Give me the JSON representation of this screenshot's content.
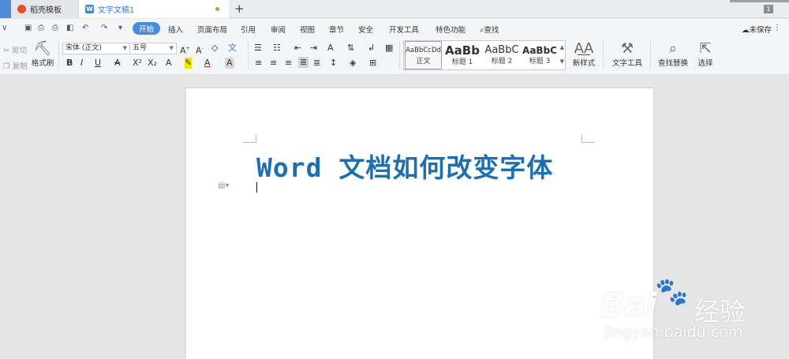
{
  "tabs": [
    {
      "label": "稻壳模板"
    },
    {
      "label": "文字文稿1"
    }
  ],
  "page_count_badge": "1",
  "quick_access": {
    "chevron": "∨"
  },
  "menu": {
    "items": [
      "开始",
      "插入",
      "页面布局",
      "引用",
      "审阅",
      "视图",
      "章节",
      "安全",
      "开发工具",
      "特色功能"
    ],
    "search": "查找",
    "unsaved": "未保存"
  },
  "ribbon": {
    "cut": "剪切",
    "copy": "复制",
    "format_painter": "格式刷",
    "font_name": "宋体 (正文)",
    "font_size": "五号",
    "styles": [
      {
        "preview": "AaBbCcDd",
        "label": "正文"
      },
      {
        "preview": "AaBb",
        "label": "标题 1"
      },
      {
        "preview": "AaBbC",
        "label": "标题 2"
      },
      {
        "preview": "AaBbC",
        "label": "标题 3"
      }
    ],
    "new_style": "新样式",
    "text_tools": "文字工具",
    "find_replace": "查找替换",
    "select": "选择"
  },
  "document": {
    "title": "Word 文档如何改变字体"
  },
  "watermark": {
    "brand": "Bai",
    "brand_cn": "经验",
    "url": "jingyan.baidu.com"
  }
}
